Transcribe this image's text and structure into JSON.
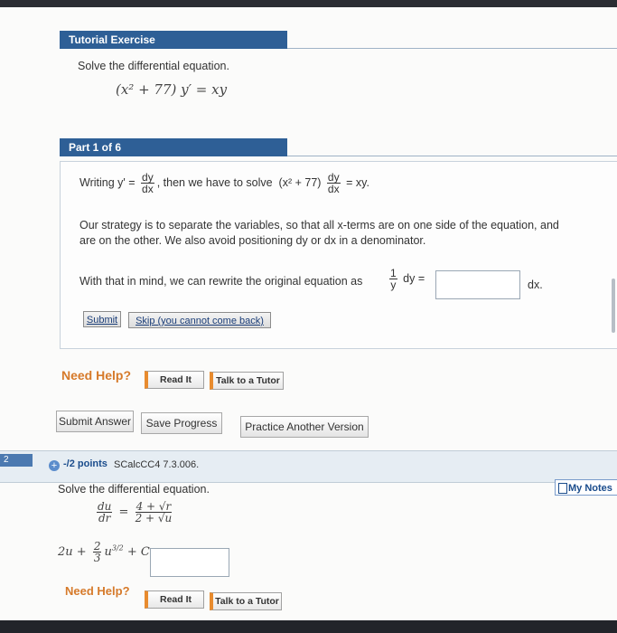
{
  "tutorial": {
    "header": "Tutorial Exercise",
    "instruction": "Solve the differential equation.",
    "equation": "(x² + 77) y′ = xy"
  },
  "part": {
    "header": "Part 1 of 6",
    "writing_prefix": "Writing y' =",
    "writing_frac_num": "dy",
    "writing_frac_den": "dx",
    "writing_middle": ", then we have to solve",
    "writing_expr": "(x² + 77)",
    "writing_frac2_num": "dy",
    "writing_frac2_den": "dx",
    "writing_suffix": "= xy.",
    "strategy_line1": "Our strategy is to separate the variables, so that all x-terms are on one side of the equation, and",
    "strategy_line2": "are on the other. We also avoid positioning dy or dx in a denominator.",
    "rewrite_text": "With that in mind, we can rewrite the original equation as",
    "rewrite_frac_num": "1",
    "rewrite_frac_den": "y",
    "rewrite_mid": "dy =",
    "rewrite_suffix": "dx.",
    "answer_value": "",
    "submit_label": "Submit",
    "skip_label": "Skip (you cannot come back)"
  },
  "help1": {
    "need_help": "Need Help?",
    "read_it": "Read It",
    "talk_tutor": "Talk to a Tutor"
  },
  "actions": {
    "submit_answer": "Submit Answer",
    "save_progress": "Save Progress",
    "practice_another": "Practice Another Version"
  },
  "question2": {
    "number": "2",
    "points": "-/2 points",
    "code": "SCalcCC4 7.3.006.",
    "my_notes": "My Notes",
    "instruction": "Solve the differential equation.",
    "eq_lhs_num": "du",
    "eq_lhs_den": "dr",
    "eq_rhs_num": "4 + √r",
    "eq_rhs_den": "2 + √u",
    "answer_prefix": "2u + ",
    "answer_frac_num": "2",
    "answer_frac_den": "3",
    "answer_power_base": "u",
    "answer_power_exp": "3/2",
    "answer_suffix": "+ C =",
    "answer_value": ""
  },
  "help2": {
    "need_help": "Need Help?",
    "read_it": "Read It",
    "talk_tutor": "Talk to a Tutor"
  },
  "colors": {
    "header_blue": "#2e5f96",
    "help_orange": "#d67a2a"
  }
}
